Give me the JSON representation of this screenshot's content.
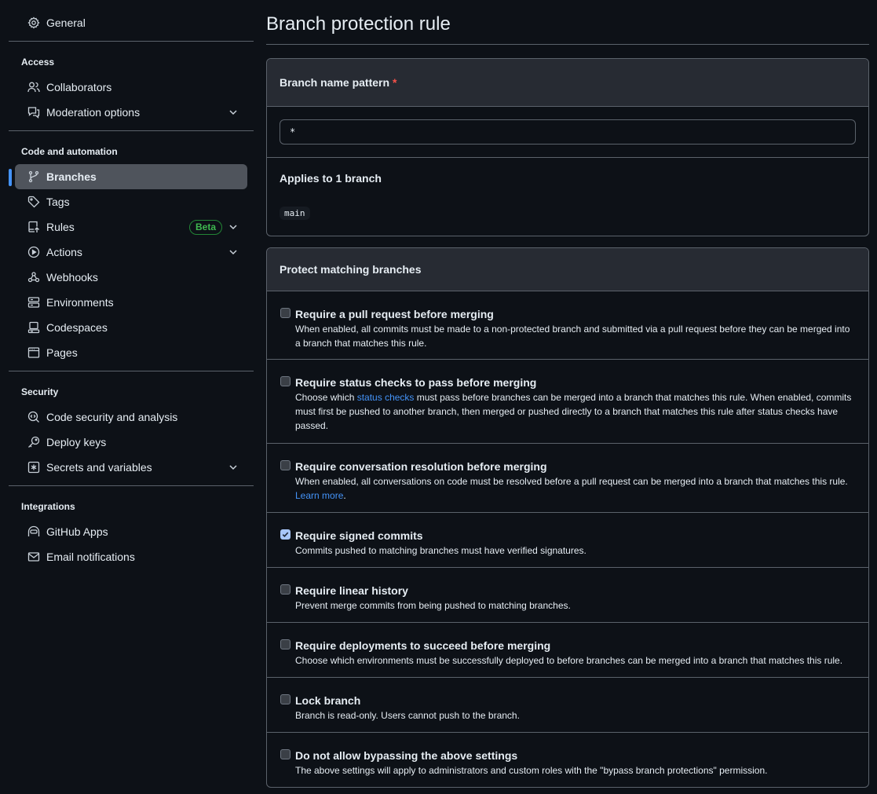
{
  "sidebar": {
    "general": {
      "label": "General",
      "icon": "gear-icon"
    },
    "sections": [
      {
        "heading": "Access",
        "items": [
          {
            "label": "Collaborators",
            "icon": "people-icon"
          },
          {
            "label": "Moderation options",
            "icon": "comment-discussion-icon",
            "expandable": true
          }
        ]
      },
      {
        "heading": "Code and automation",
        "items": [
          {
            "label": "Branches",
            "icon": "git-branch-icon",
            "active": true
          },
          {
            "label": "Tags",
            "icon": "tag-icon"
          },
          {
            "label": "Rules",
            "icon": "repo-push-icon",
            "badge": "Beta",
            "expandable": true
          },
          {
            "label": "Actions",
            "icon": "play-icon",
            "expandable": true
          },
          {
            "label": "Webhooks",
            "icon": "webhook-icon"
          },
          {
            "label": "Environments",
            "icon": "server-icon"
          },
          {
            "label": "Codespaces",
            "icon": "codespaces-icon"
          },
          {
            "label": "Pages",
            "icon": "browser-icon"
          }
        ]
      },
      {
        "heading": "Security",
        "items": [
          {
            "label": "Code security and analysis",
            "icon": "codescan-icon"
          },
          {
            "label": "Deploy keys",
            "icon": "key-icon"
          },
          {
            "label": "Secrets and variables",
            "icon": "key-asterisk-icon",
            "expandable": true
          }
        ]
      },
      {
        "heading": "Integrations",
        "items": [
          {
            "label": "GitHub Apps",
            "icon": "copilot-icon"
          },
          {
            "label": "Email notifications",
            "icon": "mail-icon"
          }
        ]
      }
    ]
  },
  "main": {
    "title": "Branch protection rule",
    "pattern_box": {
      "header": "Branch name pattern",
      "required_marker": "*",
      "input_value": "*",
      "applies_label": "Applies to 1 branch",
      "branches": [
        "main"
      ]
    },
    "protect_box": {
      "header": "Protect matching branches",
      "options": [
        {
          "title": "Require a pull request before merging",
          "desc": "When enabled, all commits must be made to a non-protected branch and submitted via a pull request before they can be merged into a branch that matches this rule.",
          "checked": false
        },
        {
          "title": "Require status checks to pass before merging",
          "desc_pre": "Choose which ",
          "desc_link": "status checks",
          "desc_post": " must pass before branches can be merged into a branch that matches this rule. When enabled, commits must first be pushed to another branch, then merged or pushed directly to a branch that matches this rule after status checks have passed.",
          "checked": false
        },
        {
          "title": "Require conversation resolution before merging",
          "desc_pre": "When enabled, all conversations on code must be resolved before a pull request can be merged into a branch that matches this rule. ",
          "desc_link": "Learn more",
          "desc_post": ".",
          "checked": false
        },
        {
          "title": "Require signed commits",
          "desc": "Commits pushed to matching branches must have verified signatures.",
          "checked": true
        },
        {
          "title": "Require linear history",
          "desc": "Prevent merge commits from being pushed to matching branches.",
          "checked": false
        },
        {
          "title": "Require deployments to succeed before merging",
          "desc": "Choose which environments must be successfully deployed to before branches can be merged into a branch that matches this rule.",
          "checked": false
        },
        {
          "title": "Lock branch",
          "desc": "Branch is read-only. Users cannot push to the branch.",
          "checked": false
        },
        {
          "title": "Do not allow bypassing the above settings",
          "desc": "The above settings will apply to administrators and custom roles with the \"bypass branch protections\" permission.",
          "checked": false
        }
      ]
    }
  },
  "colors": {
    "background": "#0d1117",
    "border": "#5b626b",
    "accent": "#4493f8",
    "beta_badge": "#3fb950",
    "required": "#f85149"
  }
}
